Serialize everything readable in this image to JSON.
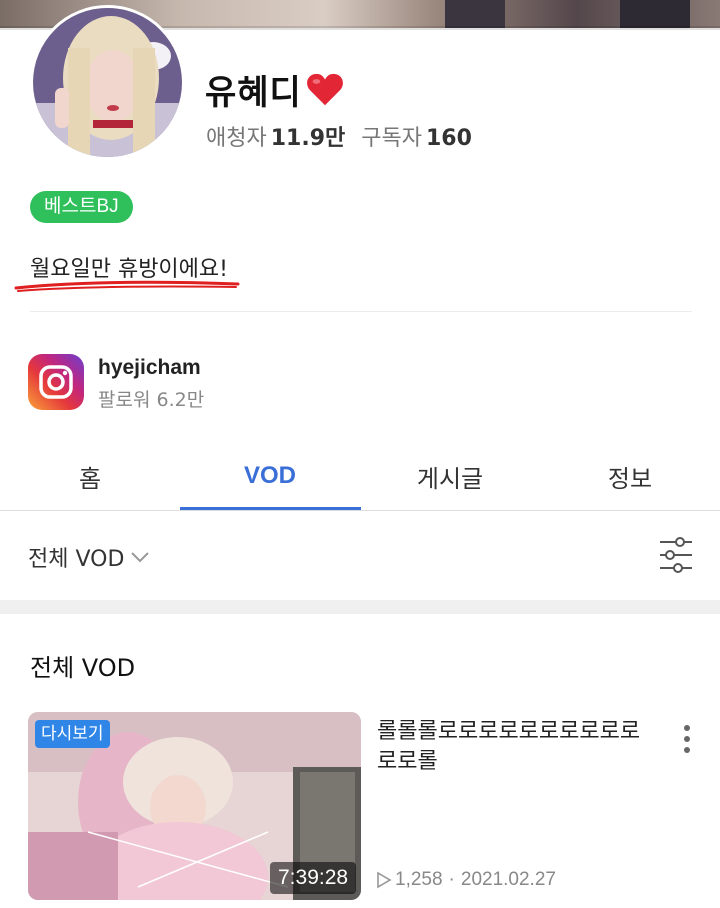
{
  "profile": {
    "name": "유혜디",
    "name_emoji": "heart-icon",
    "viewers_label": "애청자",
    "viewers_value": "11.9만",
    "subscribers_label": "구독자",
    "subscribers_value": "160",
    "badge": "베스트BJ",
    "bio": "월요일만 휴방이에요!"
  },
  "instagram": {
    "icon": "instagram-icon",
    "handle": "hyejicham",
    "followers": "팔로워 6.2만"
  },
  "tabs": [
    {
      "label": "홈",
      "active": false
    },
    {
      "label": "VOD",
      "active": true
    },
    {
      "label": "게시글",
      "active": false
    },
    {
      "label": "정보",
      "active": false
    }
  ],
  "filter": {
    "label": "전체 VOD",
    "icon": "chevron-down-icon",
    "settings_icon": "filter-sliders-icon"
  },
  "section": {
    "title": "전체 VOD"
  },
  "vod": {
    "badge": "다시보기",
    "duration": "7:39:28",
    "title": "롤롤롤로로로로로로로로로로로로롤",
    "views": "1,258",
    "separator": "·",
    "date": "2021.02.27"
  },
  "colors": {
    "accent": "#3a6fd8",
    "badge_green": "#2fbf5b",
    "replay_blue": "#2f86e6",
    "underline_red": "#e02020"
  }
}
